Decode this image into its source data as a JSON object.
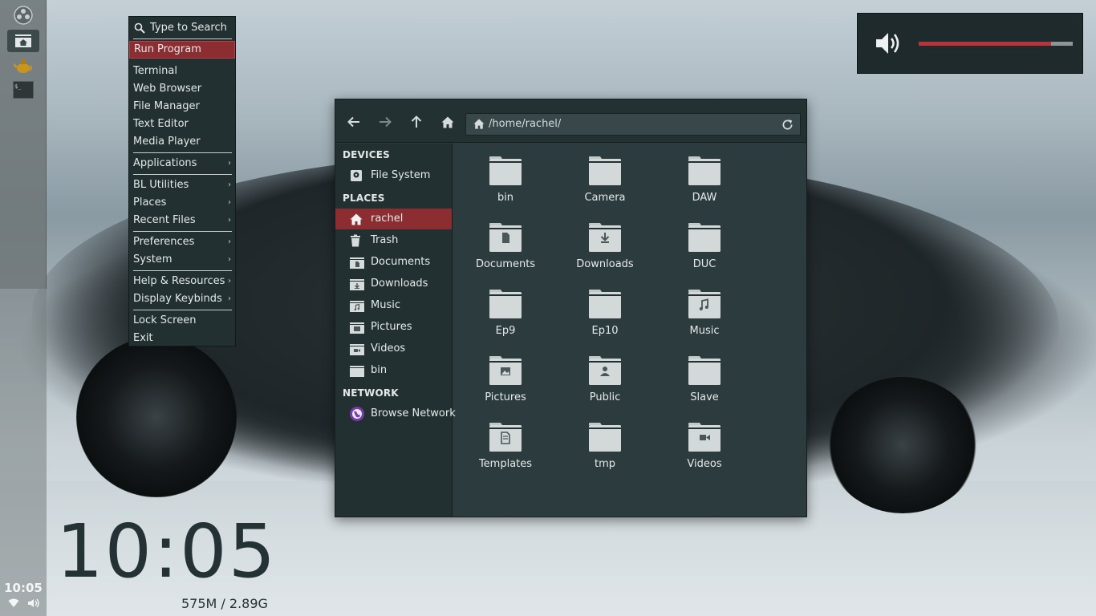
{
  "panel": {
    "clock": "10:05",
    "launchers": [
      "bunsen-menu-icon",
      "home-folder-icon",
      "teapot-icon",
      "terminal-icon"
    ]
  },
  "menu": {
    "search": "Type to Search",
    "run_program": "Run Program",
    "items": {
      "terminal": "Terminal",
      "web_browser": "Web Browser",
      "file_manager": "File Manager",
      "text_editor": "Text Editor",
      "media_player": "Media Player",
      "applications": "Applications",
      "bl_utilities": "BL Utilities",
      "places": "Places",
      "recent_files": "Recent Files",
      "preferences": "Preferences",
      "system": "System",
      "help_resources": "Help & Resources",
      "display_keybinds": "Display Keybinds",
      "lock_screen": "Lock Screen",
      "exit": "Exit"
    },
    "submenu_arrow": "›"
  },
  "volume_osd": {
    "level": 0.86,
    "accent": "#b8333a"
  },
  "file_manager": {
    "path": "/home/rachel/",
    "sidebar": {
      "devices_header": "DEVICES",
      "file_system": "File System",
      "places_header": "PLACES",
      "rachel": "rachel",
      "trash": "Trash",
      "documents": "Documents",
      "downloads": "Downloads",
      "music": "Music",
      "pictures": "Pictures",
      "videos": "Videos",
      "bin": "bin",
      "network_header": "NETWORK",
      "browse_network": "Browse Network"
    },
    "files": [
      "bin",
      "Camera",
      "DAW",
      "Documents",
      "Downloads",
      "DUC",
      "Ep9",
      "Ep10",
      "Music",
      "Pictures",
      "Public",
      "Slave",
      "Templates",
      "tmp",
      "Videos"
    ],
    "selection_color": "#8b2d31"
  },
  "conky": {
    "time": "10:05",
    "memory": "575M / 2.89G"
  }
}
